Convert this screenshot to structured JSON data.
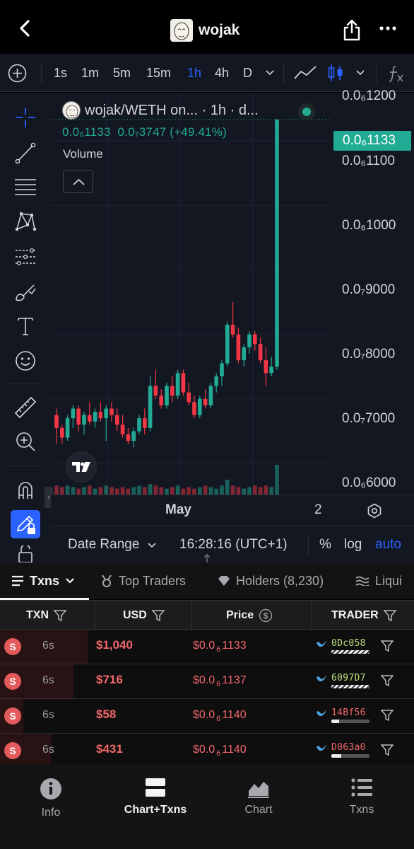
{
  "header": {
    "title": "wojak"
  },
  "toolbar": {
    "intervals": [
      "1s",
      "1m",
      "5m",
      "15m",
      "1h",
      "4h",
      "D"
    ],
    "active_interval": "1h"
  },
  "chart": {
    "legend_title": "wojak/WETH on... · 1h · d...",
    "legend_values": "0.0₆1133  0.0₇3747 (+49.41%)",
    "volume_label": "Volume",
    "last_price": "0.0₆1133",
    "price_labels": [
      "0.0₆1200",
      "0.0₆1100",
      "0.0₆1000",
      "0.0₇9000",
      "0.0₇8000",
      "0.0₇7000",
      "0.0₆6000"
    ],
    "time_labels": [
      "May",
      "2"
    ],
    "bottom": {
      "date_range": "Date Range",
      "time": "16:28:16 (UTC+1)",
      "percent": "%",
      "log": "log",
      "auto": "auto"
    }
  },
  "chart_data": {
    "type": "candlestick",
    "title": "wojak/WETH on... · 1h · d...",
    "y_axis_ticks_e8": [
      6,
      7,
      8,
      9,
      10,
      11,
      12
    ],
    "series": [
      {
        "name": "wojak/WETH",
        "ohlc_e8": [
          [
            6.75,
            6.85,
            6.3,
            6.55
          ],
          [
            6.55,
            6.6,
            6.3,
            6.4
          ],
          [
            6.4,
            6.75,
            6.35,
            6.7
          ],
          [
            6.7,
            6.9,
            6.55,
            6.85
          ],
          [
            6.85,
            6.9,
            6.5,
            6.6
          ],
          [
            6.6,
            6.8,
            6.45,
            6.75
          ],
          [
            6.75,
            6.95,
            6.6,
            6.65
          ],
          [
            6.65,
            6.85,
            6.55,
            6.8
          ],
          [
            6.8,
            6.95,
            6.65,
            6.7
          ],
          [
            6.7,
            6.9,
            6.35,
            6.85
          ],
          [
            6.85,
            6.95,
            6.65,
            6.75
          ],
          [
            6.75,
            6.85,
            6.5,
            6.6
          ],
          [
            6.6,
            6.75,
            6.4,
            6.45
          ],
          [
            6.45,
            6.55,
            6.3,
            6.35
          ],
          [
            6.35,
            6.55,
            6.25,
            6.5
          ],
          [
            6.5,
            6.75,
            6.45,
            6.7
          ],
          [
            6.7,
            6.85,
            6.45,
            6.55
          ],
          [
            6.55,
            7.35,
            6.5,
            7.2
          ],
          [
            7.2,
            7.45,
            7.0,
            7.05
          ],
          [
            7.05,
            7.15,
            6.85,
            6.9
          ],
          [
            6.9,
            7.25,
            6.85,
            7.2
          ],
          [
            7.2,
            7.35,
            6.95,
            7.05
          ],
          [
            7.05,
            7.45,
            7.0,
            7.4
          ],
          [
            7.4,
            7.45,
            7.05,
            7.1
          ],
          [
            7.1,
            7.25,
            6.9,
            6.95
          ],
          [
            6.95,
            7.05,
            6.7,
            6.75
          ],
          [
            6.75,
            7.05,
            6.7,
            7.0
          ],
          [
            7.0,
            7.15,
            6.85,
            6.9
          ],
          [
            6.9,
            7.25,
            6.85,
            7.2
          ],
          [
            7.2,
            7.4,
            7.1,
            7.35
          ],
          [
            7.35,
            7.6,
            7.2,
            7.55
          ],
          [
            7.55,
            8.2,
            7.5,
            8.15
          ],
          [
            8.15,
            8.5,
            7.95,
            8.0
          ],
          [
            8.0,
            8.1,
            7.55,
            7.6
          ],
          [
            7.6,
            7.85,
            7.5,
            7.8
          ],
          [
            7.8,
            8.05,
            7.7,
            8.0
          ],
          [
            8.0,
            8.05,
            7.75,
            7.85
          ],
          [
            7.85,
            7.95,
            7.55,
            7.6
          ],
          [
            7.6,
            7.8,
            7.2,
            7.4
          ],
          [
            7.4,
            7.65,
            7.35,
            7.5
          ],
          [
            7.5,
            11.33,
            7.45,
            11.33
          ]
        ],
        "volume_rel": [
          0.3,
          0.25,
          0.3,
          0.25,
          0.2,
          0.25,
          0.3,
          0.2,
          0.25,
          0.3,
          0.25,
          0.2,
          0.25,
          0.2,
          0.25,
          0.3,
          0.25,
          0.35,
          0.3,
          0.25,
          0.2,
          0.25,
          0.3,
          0.2,
          0.25,
          0.2,
          0.25,
          0.3,
          0.25,
          0.2,
          0.3,
          0.5,
          0.3,
          0.25,
          0.2,
          0.25,
          0.3,
          0.25,
          0.3,
          0.25,
          1.0
        ]
      }
    ]
  },
  "tabs": [
    "Txns",
    "Top Traders",
    "Holders (8,230)",
    "Liqui"
  ],
  "table": {
    "headers": [
      "TXN",
      "USD",
      "Price",
      "TRADER"
    ],
    "rows": [
      {
        "type": "S",
        "age": "6s",
        "usd": "$1,040",
        "price_prefix": "$0.0",
        "price_sub": "6",
        "price_rest": "1133",
        "trader": "0Dc058",
        "trader_color": "#b8e07a",
        "bar_fill": 1.0,
        "bar_style": "stripe"
      },
      {
        "type": "S",
        "age": "6s",
        "usd": "$716",
        "price_prefix": "$0.0",
        "price_sub": "6",
        "price_rest": "1137",
        "trader": "6097D7",
        "trader_color": "#b8e07a",
        "bar_fill": 1.0,
        "bar_style": "stripe"
      },
      {
        "type": "S",
        "age": "6s",
        "usd": "$58",
        "price_prefix": "$0.0",
        "price_sub": "6",
        "price_rest": "1140",
        "trader": "14Bf56",
        "trader_color": "#f0676a",
        "bar_fill": 0.2,
        "bar_style": "solid"
      },
      {
        "type": "S",
        "age": "6s",
        "usd": "$431",
        "price_prefix": "$0.0",
        "price_sub": "6",
        "price_rest": "1140",
        "trader": "D063a0",
        "trader_color": "#f0676a",
        "bar_fill": 0.25,
        "bar_style": "solid"
      }
    ]
  },
  "nav": [
    "Info",
    "Chart+Txns",
    "Chart",
    "Txns"
  ],
  "colors": {
    "up": "#22ab94",
    "down": "#f23645",
    "accent": "#2962ff",
    "sell": "#f0676a"
  }
}
